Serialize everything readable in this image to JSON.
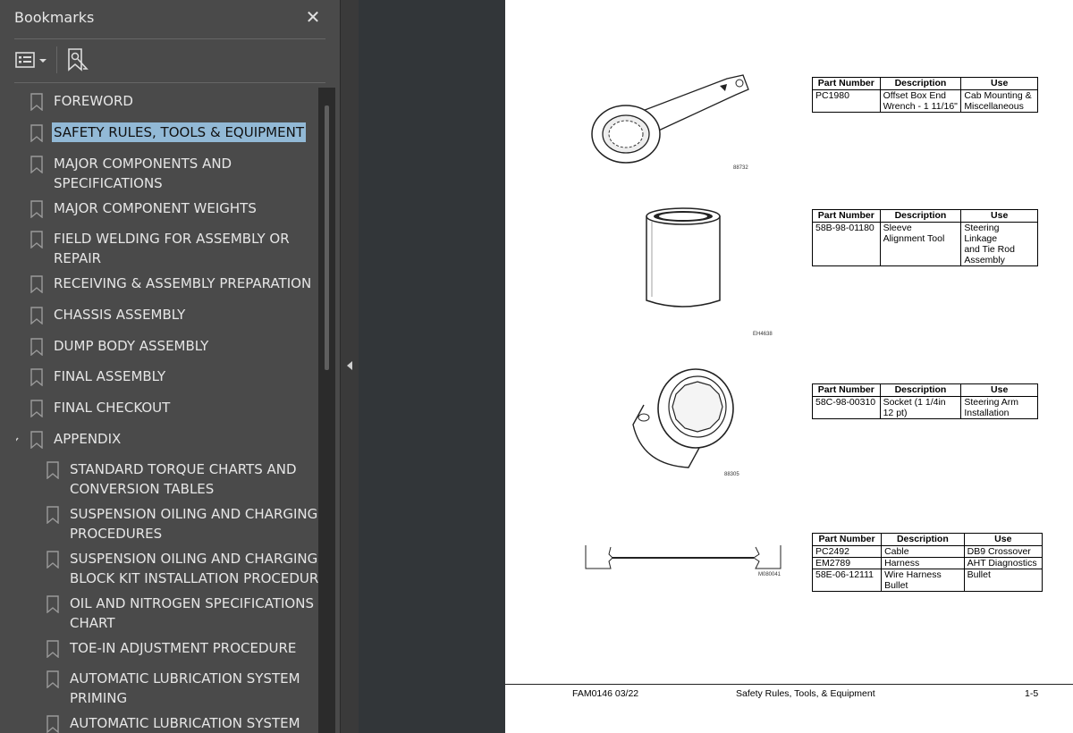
{
  "sidebar": {
    "title": "Bookmarks",
    "close_icon": "close-icon",
    "toolbar": {
      "options_icon": "list-options-icon",
      "find_icon": "find-bookmark-icon"
    },
    "items": [
      {
        "lines": [
          "FOREWORD"
        ]
      },
      {
        "lines": [
          "SAFETY RULES, TOOLS & EQUIPMENT"
        ],
        "selected": true
      },
      {
        "lines": [
          "MAJOR COMPONENTS AND",
          "SPECIFICATIONS"
        ]
      },
      {
        "lines": [
          "MAJOR COMPONENT WEIGHTS"
        ]
      },
      {
        "lines": [
          "FIELD WELDING FOR ASSEMBLY OR",
          "REPAIR"
        ]
      },
      {
        "lines": [
          "RECEIVING & ASSEMBLY PREPARATION"
        ]
      },
      {
        "lines": [
          "CHASSIS ASSEMBLY"
        ]
      },
      {
        "lines": [
          "DUMP BODY ASSEMBLY"
        ]
      },
      {
        "lines": [
          "FINAL ASSEMBLY"
        ]
      },
      {
        "lines": [
          "FINAL CHECKOUT"
        ]
      },
      {
        "lines": [
          "APPENDIX"
        ],
        "expanded": true
      },
      {
        "lines": [
          "STANDARD TORQUE CHARTS AND",
          "CONVERSION TABLES"
        ],
        "child": true
      },
      {
        "lines": [
          "SUSPENSION OILING AND CHARGING",
          "PROCEDURES"
        ],
        "child": true
      },
      {
        "lines": [
          "SUSPENSION OILING AND CHARGING",
          "BLOCK KIT INSTALLATION PROCEDURE"
        ],
        "child": true
      },
      {
        "lines": [
          "OIL AND NITROGEN SPECIFICATIONS",
          "CHART"
        ],
        "child": true
      },
      {
        "lines": [
          "TOE-IN ADJUSTMENT PROCEDURE"
        ],
        "child": true
      },
      {
        "lines": [
          "AUTOMATIC LUBRICATION SYSTEM",
          "PRIMING"
        ],
        "child": true
      },
      {
        "lines": [
          "AUTOMATIC LUBRICATION SYSTEM"
        ],
        "child": true
      }
    ]
  },
  "document": {
    "table_headers": [
      "Part Number",
      "Description",
      "Use"
    ],
    "tables": [
      {
        "figure_id": "88732",
        "rows": [
          {
            "part": "PC1980",
            "desc": [
              "Offset Box End",
              "Wrench - 1 11/16\""
            ],
            "use": [
              "Cab Mounting &",
              "Miscellaneous"
            ]
          }
        ]
      },
      {
        "figure_id": "EH4638",
        "rows": [
          {
            "part": "58B-98-01180",
            "desc": [
              "Sleeve",
              "Alignment Tool"
            ],
            "use": [
              "Steering Linkage",
              "and Tie Rod",
              "Assembly"
            ]
          }
        ]
      },
      {
        "figure_id": "88305",
        "rows": [
          {
            "part": "58C-98-00310",
            "desc": [
              "Socket (1 1/4in",
              "12 pt)"
            ],
            "use": [
              "Steering Arm",
              "Installation"
            ]
          }
        ]
      },
      {
        "figure_id": "M080041",
        "rows": [
          {
            "part": "PC2492",
            "desc": [
              "Cable"
            ],
            "use": [
              "DB9 Crossover"
            ]
          },
          {
            "part": "EM2789",
            "desc": [
              "Harness"
            ],
            "use": [
              "AHT Diagnostics"
            ]
          },
          {
            "part": "58E-06-12111",
            "desc": [
              "Wire Harness",
              "Bullet"
            ],
            "use": [
              "Bullet"
            ]
          }
        ]
      }
    ],
    "footer": {
      "doc_id": "FAM0146   03/22",
      "section": "Safety Rules, Tools, & Equipment",
      "page": "1-5"
    }
  }
}
